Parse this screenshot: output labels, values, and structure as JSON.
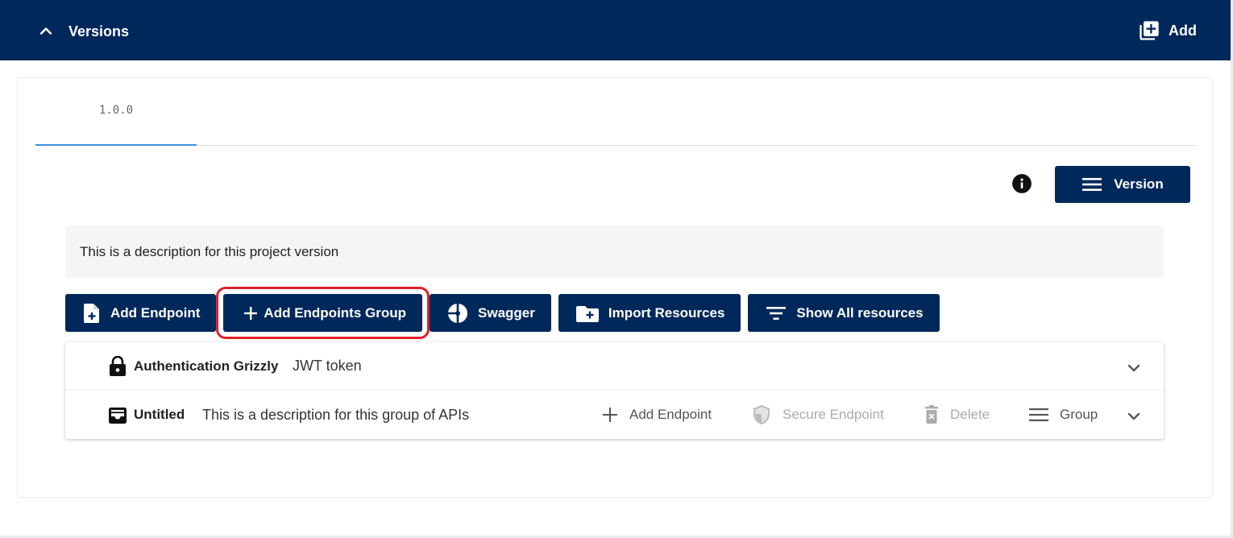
{
  "header": {
    "title": "Versions",
    "add_label": "Add",
    "bg_color": "#00285a"
  },
  "tabs": [
    {
      "label": "1.0.0",
      "active": true
    }
  ],
  "toolbar_top": {
    "version_label": "Version"
  },
  "version_description": "This is a description for this project version",
  "toolbar": {
    "add_endpoint": "Add Endpoint",
    "add_group": "Add Endpoints Group",
    "swagger": "Swagger",
    "import_resources": "Import Resources",
    "show_all": "Show All resources"
  },
  "groups": [
    {
      "icon": "lock-icon",
      "name": "Authentication Grizzly",
      "description": "JWT token"
    },
    {
      "icon": "inbox-icon",
      "name": "Untitled",
      "description": "This is a description for this group of APIs",
      "actions": {
        "add_endpoint": "Add Endpoint",
        "secure_endpoint": "Secure Endpoint",
        "delete": "Delete",
        "group": "Group"
      }
    }
  ],
  "colors": {
    "primary": "#00285a",
    "highlight": "#e0202a",
    "tab_underline": "#3f8fd8"
  }
}
